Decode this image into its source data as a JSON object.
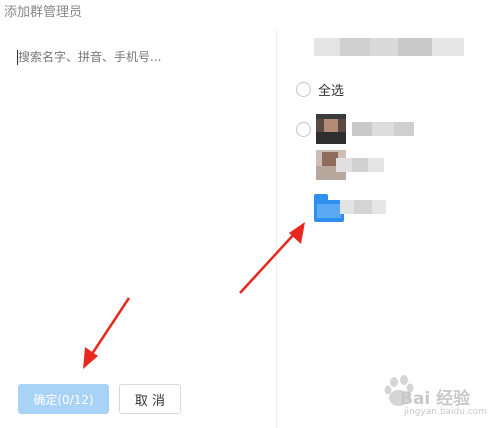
{
  "dialog": {
    "title": "添加群管理员"
  },
  "search": {
    "placeholder": "搜索名字、拼音、手机号..."
  },
  "member_list": {
    "select_all_label": "全选"
  },
  "buttons": {
    "confirm_label": "确定(0/12)",
    "cancel_label": "取 消"
  },
  "colors": {
    "confirm_disabled_bg": "#a9d2f7",
    "annotation_arrow": "#e8271e",
    "folder_avatar": "#2e8fef"
  },
  "watermark": {
    "text": "Bai 经验",
    "url": "jingyan.baidu.com"
  }
}
